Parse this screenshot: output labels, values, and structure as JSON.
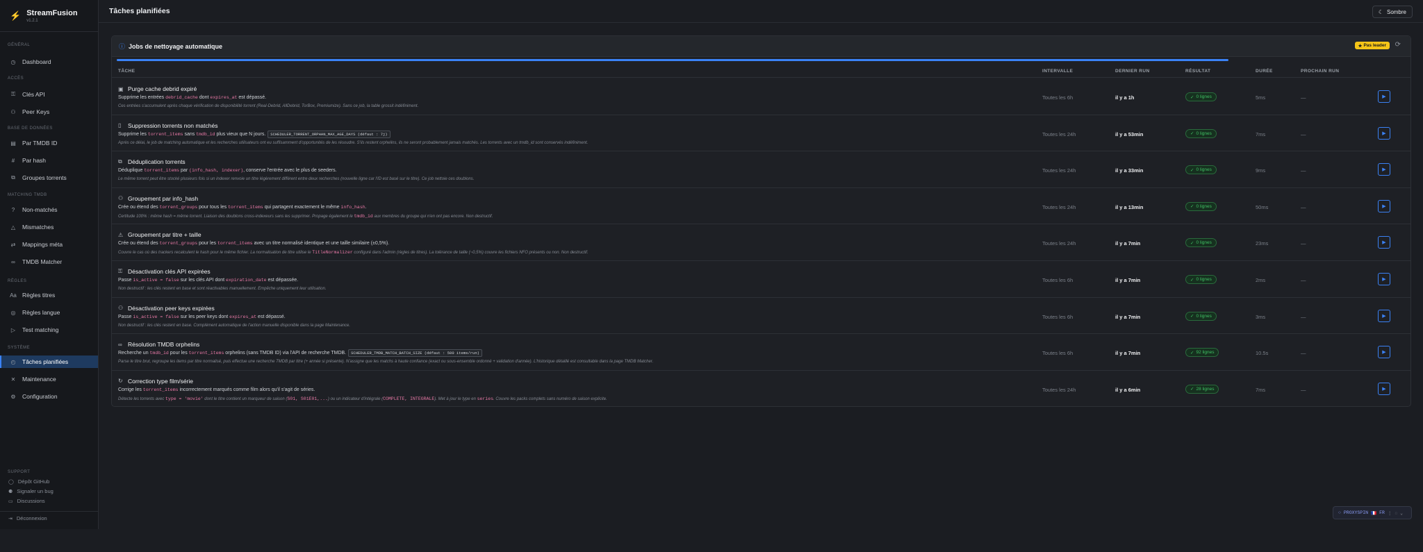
{
  "app": {
    "name": "StreamFusion",
    "version": "v1.2.1"
  },
  "sidebar": {
    "sections": [
      {
        "label": "Général",
        "items": [
          {
            "icon": "dashboard-icon",
            "glyph": "◷",
            "label": "Dashboard"
          }
        ]
      },
      {
        "label": "Accès",
        "items": [
          {
            "icon": "key-icon",
            "glyph": "⚿",
            "label": "Clés API"
          },
          {
            "icon": "users-icon",
            "glyph": "⚇",
            "label": "Peer Keys"
          }
        ]
      },
      {
        "label": "Base de données",
        "items": [
          {
            "icon": "film-icon",
            "glyph": "▤",
            "label": "Par TMDB ID"
          },
          {
            "icon": "hash-icon",
            "glyph": "#",
            "label": "Par hash"
          },
          {
            "icon": "layers-icon",
            "glyph": "⧉",
            "label": "Groupes torrents"
          }
        ]
      },
      {
        "label": "Matching TMDB",
        "items": [
          {
            "icon": "help-circle-icon",
            "glyph": "?",
            "label": "Non-matchés"
          },
          {
            "icon": "alert-triangle-icon",
            "glyph": "△",
            "label": "Mismatches"
          },
          {
            "icon": "shuffle-icon",
            "glyph": "⇄",
            "label": "Mappings méta"
          },
          {
            "icon": "link-icon",
            "glyph": "∞",
            "label": "TMDB Matcher"
          }
        ]
      },
      {
        "label": "Règles",
        "items": [
          {
            "icon": "text-icon",
            "glyph": "Aa",
            "label": "Règles titres"
          },
          {
            "icon": "globe-icon",
            "glyph": "◎",
            "label": "Règles langue"
          },
          {
            "icon": "play-circle-icon",
            "glyph": "▷",
            "label": "Test matching"
          }
        ]
      },
      {
        "label": "Système",
        "items": [
          {
            "icon": "clock-icon",
            "glyph": "◴",
            "label": "Tâches planifiées",
            "active": true
          },
          {
            "icon": "wrench-icon",
            "glyph": "✕",
            "label": "Maintenance"
          },
          {
            "icon": "settings-icon",
            "glyph": "⚙",
            "label": "Configuration"
          }
        ]
      }
    ],
    "support": {
      "label": "Support",
      "links": [
        {
          "icon": "github-icon",
          "glyph": "◯",
          "label": "Dépôt GitHub"
        },
        {
          "icon": "bug-icon",
          "glyph": "⚈",
          "label": "Signaler un bug"
        },
        {
          "icon": "discussion-icon",
          "glyph": "▭",
          "label": "Discussions"
        }
      ]
    },
    "logout": {
      "icon": "logout-icon",
      "glyph": "⇥",
      "label": "Déconnexion"
    }
  },
  "header": {
    "title": "Tâches planifiées",
    "theme_label": "Sombre",
    "theme_icon": "moon-icon"
  },
  "card": {
    "title": "Jobs de nettoyage automatique",
    "badge": "Pas leader",
    "progress": 0.86,
    "columns": {
      "task": "TÂCHE",
      "interval": "INTERVALLE",
      "last_run": "DERNIER RUN",
      "result": "RÉSULTAT",
      "duration": "DURÉE",
      "next_run": "PROCHAIN RUN"
    },
    "rows": [
      {
        "icon": "database-icon",
        "glyph": "▣",
        "name": "Purge cache debrid expiré",
        "desc": [
          "Supprime les entrées ",
          {
            "code": "debrid_cache"
          },
          " dont ",
          {
            "code": "expires_at"
          },
          " est dépassé."
        ],
        "note": [
          "Ces entrées s'accumulent après chaque vérification de disponibilité torrent (Real-Debrid, AllDebrid, TorBox, Premiumize). Sans ce job, la table grossit indéfiniment."
        ],
        "interval": "Toutes les 6h",
        "last_run": "il y a 1h",
        "result": "0 lignes",
        "duration": "5ms",
        "next_run": "—"
      },
      {
        "icon": "file-icon",
        "glyph": "▯",
        "name": "Suppression torrents non matchés",
        "desc": [
          "Supprime les ",
          {
            "code": "torrent_items"
          },
          " sans ",
          {
            "code": "tmdb_id"
          },
          " plus vieux que N jours.",
          {
            "chip": "SCHEDULER_TORRENT_ORPHAN_MAX_AGE_DAYS (défaut : 7j)"
          }
        ],
        "note": [
          "Après ce délai, le job de matching automatique et les recherches utilisateurs ont eu suffisamment d'opportunités de les résoudre. S'ils restent orphelins, ils ne seront probablement jamais matchés. Les torrents avec un tmdb_id sont conservés indéfiniment."
        ],
        "interval": "Toutes les 24h",
        "last_run": "il y a 53min",
        "result": "0 lignes",
        "duration": "7ms",
        "next_run": "—"
      },
      {
        "icon": "copy-icon",
        "glyph": "⧉",
        "name": "Déduplication torrents",
        "desc": [
          "Déduplique ",
          {
            "code": "torrent_items"
          },
          " par ",
          {
            "code": "(info_hash, indexer)"
          },
          ", conserve l'entrée avec le plus de seeders."
        ],
        "note": [
          "Le même torrent peut être stocké plusieurs fois si un indexer renvoie un titre légèrement différent entre deux recherches (nouvelle ligne car l'ID est basé sur le titre). Ce job nettoie ces doublons."
        ],
        "interval": "Toutes les 24h",
        "last_run": "il y a 33min",
        "result": "0 lignes",
        "duration": "9ms",
        "next_run": "—"
      },
      {
        "icon": "group-icon",
        "glyph": "⚇",
        "name": "Groupement par info_hash",
        "desc": [
          "Crée ou étend des ",
          {
            "code": "torrent_groups"
          },
          " pour tous les ",
          {
            "code": "torrent_items"
          },
          " qui partagent exactement le même ",
          {
            "code": "info_hash"
          },
          "."
        ],
        "note": [
          "Certitude 100% : même hash = même torrent. Liaison des doublons cross-indexeurs sans les supprimer. Propage également le ",
          {
            "code": "tmdb_id"
          },
          " aux membres du groupe qui n'en ont pas encore. Non destructif."
        ],
        "interval": "Toutes les 24h",
        "last_run": "il y a 13min",
        "result": "0 lignes",
        "duration": "50ms",
        "next_run": "—"
      },
      {
        "icon": "filter-icon",
        "glyph": "⚠",
        "name": "Groupement par titre + taille",
        "desc": [
          "Crée ou étend des ",
          {
            "code": "torrent_groups"
          },
          " pour les ",
          {
            "code": "torrent_items"
          },
          " avec un titre normalisé identique et une taille similaire (±0,5%)."
        ],
        "note": [
          "Couvre le cas où des trackers recalculent le hash pour le même fichier. La normalisation de titre utilise le ",
          {
            "code": "TitleNormalizer"
          },
          " configuré dans l'admin (règles de titres). La tolérance de taille (~0,5%) couvre les fichiers NFO présents ou non. Non destructif."
        ],
        "interval": "Toutes les 24h",
        "last_run": "il y a 7min",
        "result": "0 lignes",
        "duration": "23ms",
        "next_run": "—"
      },
      {
        "icon": "key-off-icon",
        "glyph": "⚿",
        "name": "Désactivation clés API expirées",
        "desc": [
          "Passe ",
          {
            "code": "is_active = false"
          },
          " sur les clés API dont ",
          {
            "code": "expiration_date"
          },
          " est dépassée."
        ],
        "note": [
          "Non destructif : les clés restent en base et sont réactivables manuellement. Empêche uniquement leur utilisation."
        ],
        "interval": "Toutes les 6h",
        "last_run": "il y a 7min",
        "result": "0 lignes",
        "duration": "2ms",
        "next_run": "—"
      },
      {
        "icon": "users-off-icon",
        "glyph": "⚇",
        "name": "Désactivation peer keys expirées",
        "desc": [
          "Passe ",
          {
            "code": "is_active = false"
          },
          " sur les peer keys dont ",
          {
            "code": "expires_at"
          },
          " est dépassé."
        ],
        "note": [
          "Non destructif : les clés restent en base. Complément automatique de l'action manuelle disponible dans la page Maintenance."
        ],
        "interval": "Toutes les 6h",
        "last_run": "il y a 7min",
        "result": "0 lignes",
        "duration": "3ms",
        "next_run": "—"
      },
      {
        "icon": "link-icon",
        "glyph": "∞",
        "name": "Résolution TMDB orphelins",
        "desc": [
          "Recherche un ",
          {
            "code": "tmdb_id"
          },
          " pour les ",
          {
            "code": "torrent_items"
          },
          " orphelins (sans TMDB ID) via l'API de recherche TMDB.",
          {
            "chip": "SCHEDULER_TMDB_MATCH_BATCH_SIZE (défaut : 500 items/run)"
          }
        ],
        "note": [
          "Parse le titre brut, regroupe les items par titre normalisé, puis effectue une recherche TMDB par titre (+ année si présente). N'assigne que les matchs à haute confiance (exact ou sous-ensemble ordonné + validation d'année). L'historique détaillé est consultable dans la page TMDB Matcher."
        ],
        "interval": "Toutes les 6h",
        "last_run": "il y a 7min",
        "result": "92 lignes",
        "duration": "10.5s",
        "next_run": "—"
      },
      {
        "icon": "refresh-icon",
        "glyph": "↻",
        "name": "Correction type film/série",
        "desc": [
          "Corrige les ",
          {
            "code": "torrent_items"
          },
          " incorrectement marqués comme film alors qu'il s'agit de séries."
        ],
        "note": [
          "Détecte les torrents avec ",
          {
            "code": "type = 'movie'"
          },
          " dont le titre contient un marqueur de saison (",
          {
            "code": "S01, S01E01,..."
          },
          ") ou un indicateur d'intégrale (",
          {
            "code": "COMPLETE, INTEGRALE"
          },
          "). Met à jour le type en ",
          {
            "code": "series"
          },
          ". Couvre les packs complets sans numéro de saison explicite."
        ],
        "interval": "Toutes les 24h",
        "last_run": "il y a 6min",
        "result": "28 lignes",
        "duration": "7ms",
        "next_run": "—"
      }
    ]
  },
  "proxy": {
    "label": "PROXYSPIN",
    "flag": "🇫🇷",
    "lang": "FR"
  },
  "colors": {
    "accent": "#3b82f6",
    "active_bg": "#1e3a5f",
    "success": "#3fbf63",
    "badge": "#f5c518",
    "code": "#e879a6"
  }
}
